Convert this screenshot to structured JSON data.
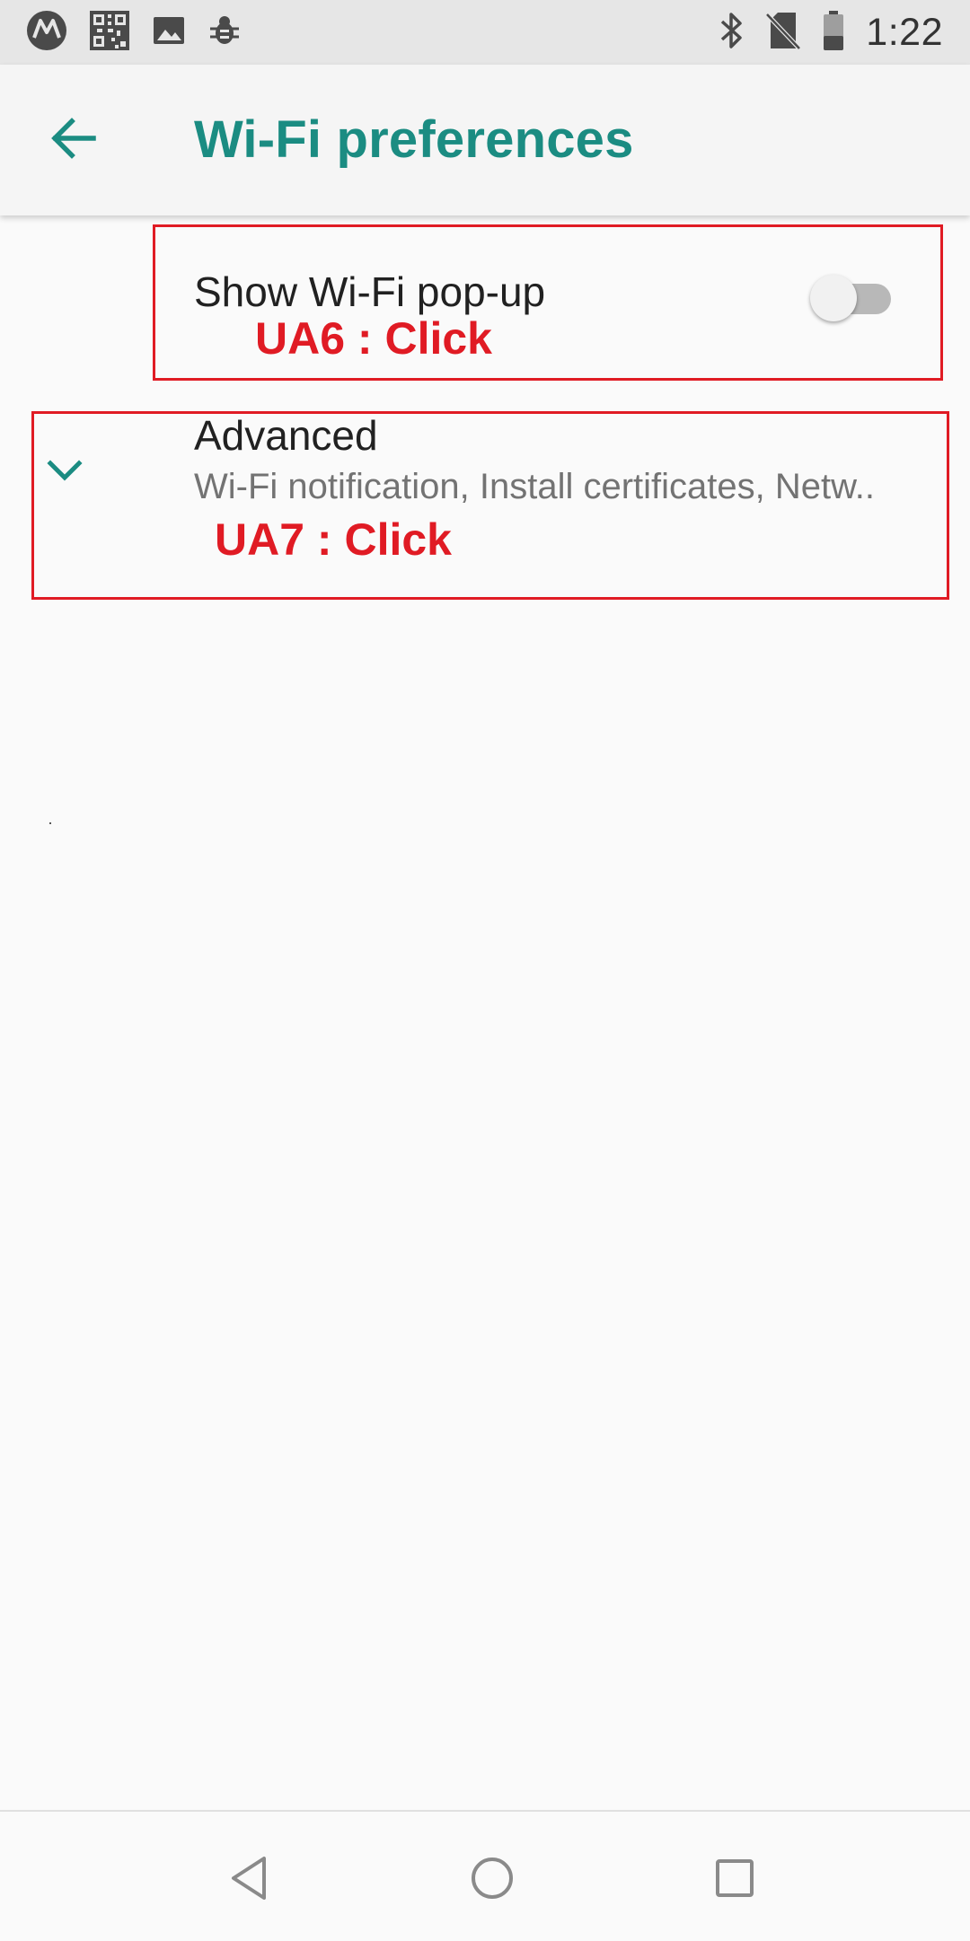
{
  "status_bar": {
    "time": "1:22",
    "left_icons": [
      "motorola-logo-icon",
      "qr-code-icon",
      "image-icon",
      "bug-icon"
    ],
    "right_icons": [
      "bluetooth-icon",
      "no-sim-icon",
      "battery-icon"
    ]
  },
  "toolbar": {
    "back_icon": "arrow-back-icon",
    "title": "Wi-Fi preferences",
    "accent_color": "#1b8c82"
  },
  "preferences": {
    "show_popup": {
      "title": "Show Wi-Fi pop-up",
      "toggle_on": false
    },
    "advanced": {
      "icon": "chevron-down-icon",
      "title": "Advanced",
      "summary": "Wi-Fi notification, Install certificates, Netw.."
    }
  },
  "annotations": {
    "ua6": "UA6 : Click",
    "ua7": "UA7 : Click",
    "color": "#e01b24"
  },
  "nav_bar": {
    "back": "nav-back-icon",
    "home": "nav-home-icon",
    "recents": "nav-recents-icon"
  }
}
